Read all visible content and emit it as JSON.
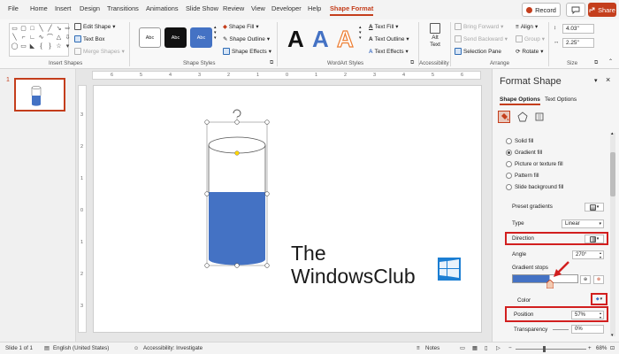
{
  "tabs": {
    "items": [
      "File",
      "Home",
      "Insert",
      "Design",
      "Transitions",
      "Animations",
      "Slide Show",
      "Review",
      "View",
      "Developer",
      "Help",
      "Shape Format"
    ],
    "record_label": "Record",
    "share_label": "Share"
  },
  "ribbon": {
    "insert_shapes": {
      "label": "Insert Shapes",
      "edit_shape": "Edit Shape",
      "text_box": "Text Box",
      "merge_shapes": "Merge Shapes"
    },
    "shape_styles": {
      "label": "Shape Styles",
      "thumb_text": "Abc",
      "shape_fill": "Shape Fill",
      "shape_outline": "Shape Outline",
      "shape_effects": "Shape Effects"
    },
    "wordart": {
      "label": "WordArt Styles",
      "glyph": "A",
      "text_fill": "Text Fill",
      "text_outline": "Text Outline",
      "text_effects": "Text Effects"
    },
    "accessibility": {
      "label": "Accessibility",
      "alt_text_line1": "Alt",
      "alt_text_line2": "Text"
    },
    "arrange": {
      "label": "Arrange",
      "bring_forward": "Bring Forward",
      "send_backward": "Send Backward",
      "selection_pane": "Selection Pane",
      "align": "Align",
      "group": "Group",
      "rotate": "Rotate"
    },
    "size": {
      "label": "Size",
      "height": "4.03\"",
      "width": "2.25\""
    }
  },
  "thumbnail": {
    "number": "1"
  },
  "ruler": {
    "h_ticks": [
      "6",
      "5",
      "4",
      "3",
      "2",
      "1",
      "0",
      "1",
      "2",
      "3",
      "4",
      "5",
      "6"
    ],
    "v_ticks": [
      "3",
      "2",
      "1",
      "0",
      "1",
      "2",
      "3"
    ]
  },
  "watermark": {
    "line1": "The",
    "line2": "WindowsClub"
  },
  "pane": {
    "title": "Format Shape",
    "tab_shape_options": "Shape Options",
    "tab_text_options": "Text Options",
    "fill_options": [
      "Solid fill",
      "Gradient fill",
      "Picture or texture fill",
      "Pattern fill",
      "Slide background fill"
    ],
    "preset_gradients": "Preset gradients",
    "type_label": "Type",
    "type_value": "Linear",
    "direction_label": "Direction",
    "angle_label": "Angle",
    "angle_value": "270°",
    "gradient_stops_label": "Gradient stops",
    "color_label": "Color",
    "position_label": "Position",
    "position_value": "57%",
    "transparency_label": "Transparency",
    "transparency_value": "0%"
  },
  "statusbar": {
    "slide": "Slide 1 of 1",
    "language": "English (United States)",
    "accessibility": "Accessibility: Investigate",
    "notes": "Notes",
    "zoom": "68%"
  },
  "colors": {
    "accent": "#c43e1c",
    "shape_fill": "#4472c4",
    "highlight": "#d21f1f"
  },
  "gradient": {
    "stop_position": 0.57
  }
}
